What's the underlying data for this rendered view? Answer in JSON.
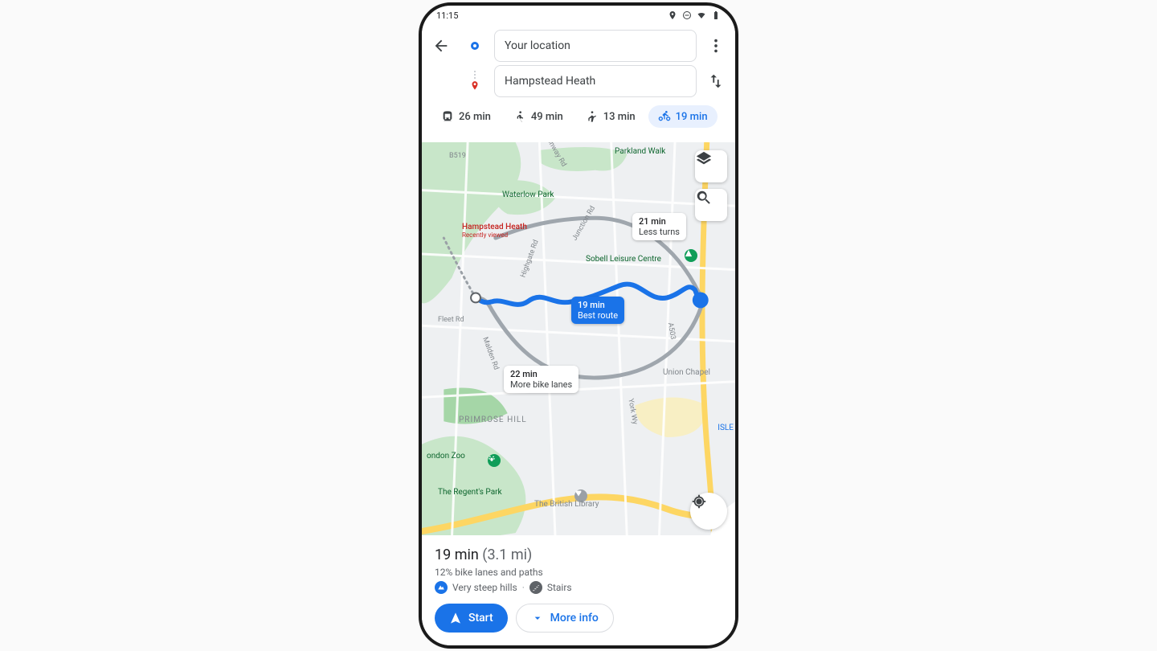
{
  "status": {
    "time": "11:15"
  },
  "header": {
    "origin": "Your location",
    "destination": "Hampstead Heath",
    "modes": [
      {
        "key": "transit",
        "label": "26 min",
        "active": false
      },
      {
        "key": "walk",
        "label": "49 min",
        "active": false
      },
      {
        "key": "ride",
        "label": "13 min",
        "active": false
      },
      {
        "key": "bike",
        "label": "19 min",
        "active": true
      }
    ]
  },
  "map": {
    "destination_label": "Hampstead Heath",
    "destination_sub": "Recently viewed",
    "parks": [
      "Parkland Walk",
      "Waterlow Park",
      "The Regent's Park",
      "PRIMROSE HILL"
    ],
    "pois": [
      "Sobell Leisure Centre",
      "Union Chapel",
      "The British Library",
      "ondon Zoo",
      "ISLE"
    ],
    "roads": [
      "B519",
      "Junction Rd",
      "Fleet Rd",
      "Malden Rd",
      "York Wy",
      "A503",
      "Highgate Rd",
      "onway Rd"
    ],
    "routes": {
      "primary": {
        "time": "19 min",
        "desc": "Best route"
      },
      "alt1": {
        "time": "21 min",
        "desc": "Less turns"
      },
      "alt2": {
        "time": "22 min",
        "desc": "More bike lanes"
      }
    }
  },
  "sheet": {
    "title_time": "19 min",
    "title_dist": "(3.1 mi)",
    "subtitle": "12% bike lanes and paths",
    "tags": [
      {
        "icon": "hills",
        "label": "Very steep hills"
      },
      {
        "icon": "stairs",
        "label": "Stairs"
      }
    ],
    "start_label": "Start",
    "more_label": "More info"
  }
}
